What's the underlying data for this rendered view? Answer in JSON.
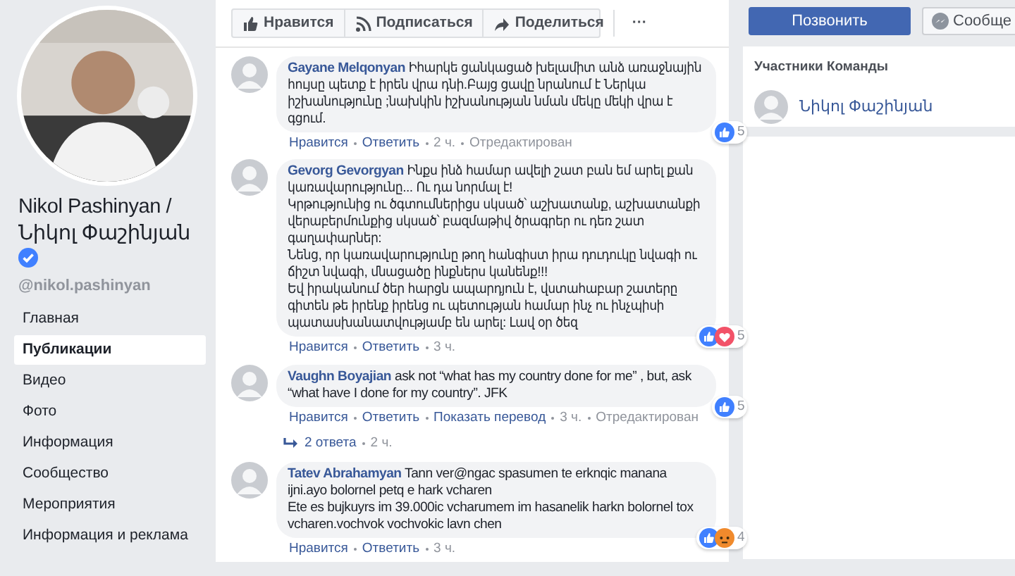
{
  "sidebar": {
    "page_name": "Nikol Pashinyan / Նիկոլ Փաշինյան",
    "verified": true,
    "handle": "@nikol.pashinyan",
    "nav": [
      {
        "label": "Главная",
        "selected": false
      },
      {
        "label": "Публикации",
        "selected": true
      },
      {
        "label": "Видео",
        "selected": false
      },
      {
        "label": "Фото",
        "selected": false
      },
      {
        "label": "Информация",
        "selected": false
      },
      {
        "label": "Сообщество",
        "selected": false
      },
      {
        "label": "Мероприятия",
        "selected": false
      },
      {
        "label": "Информация и реклама",
        "selected": false
      }
    ]
  },
  "action_bar": [
    {
      "kind": "like",
      "label": "Нравится"
    },
    {
      "kind": "follow",
      "label": "Подписаться"
    },
    {
      "kind": "share",
      "label": "Поделиться"
    },
    {
      "kind": "more",
      "label": "···"
    }
  ],
  "comments": [
    {
      "author": "Gayane Melqonyan",
      "text": "Իհարկե ցանկացած խելամիտ անձ առաջնային հույսը պետք է իրեն վրա դնի.Բայց ցավը նրանում է Ներկա իշխանությունը ;նախկին իշխանության նման մեկը մեկի վրա է գցում.",
      "reactions": [
        {
          "kind": "like"
        }
      ],
      "reaction_count": "5",
      "meta": [
        {
          "kind": "link",
          "text": "Нравится"
        },
        {
          "kind": "link",
          "text": "Ответить"
        },
        {
          "kind": "plain",
          "text": "2 ч."
        },
        {
          "kind": "plain",
          "text": "Отредактирован"
        }
      ]
    },
    {
      "author": "Gevorg Gevorgyan",
      "text": "Ինքս ինձ համար ավելի շատ բան եմ արել քան կառավարությունը... Ու դա նորմալ է!\nԿրթությունից ու ծգտումներիցս սկսած՝ աշխատանք, աշխատանքի վերաբերմունքից սկսած՝ բազմաթիվ ծրագրեր ու դեռ շատ գաղափարներ:\nՆենց, որ կառավարությունը թող հանգիստ իրա դուդուկը նվագի ու ճիշտ նվագի, մնացածը ինքներս կանենք!!!\nԵվ իրականում ծեր հարցն ապարդյուն է, վստահաբար շատերը գիտեն թե իրենք իրենց ու պետության համար ինչ ու ինչպիսի պատասխանատվությամբ են արել: Լավ օր ծեզ",
      "reactions": [
        {
          "kind": "like"
        },
        {
          "kind": "love"
        }
      ],
      "reaction_count": "5",
      "meta": [
        {
          "kind": "link",
          "text": "Нравится"
        },
        {
          "kind": "link",
          "text": "Ответить"
        },
        {
          "kind": "plain",
          "text": "3 ч."
        }
      ]
    },
    {
      "author": "Vaughn Boyajian",
      "text": "ask not “what has my country done for me” , but, ask “what have I done for my country”. JFK",
      "reactions": [
        {
          "kind": "like"
        }
      ],
      "reaction_count": "5",
      "meta": [
        {
          "kind": "link",
          "text": "Нравится"
        },
        {
          "kind": "link",
          "text": "Ответить"
        },
        {
          "kind": "link",
          "text": "Показать перевод"
        },
        {
          "kind": "plain",
          "text": "3 ч."
        },
        {
          "kind": "plain",
          "text": "Отредактирован"
        }
      ],
      "replies": {
        "label": "2 ответа",
        "time": "2 ч."
      }
    },
    {
      "author": "Tatev Abrahamyan",
      "text": "Tann ver@ngac spasumen te erknqic manana ijni.ayo bolornel petq e hark vcharen\nEte es bujkuyrs im 39.000ic vcharumem im hasanelik harkn bolornel tox vcharen.vochvok vochvokic lavn chen",
      "reactions": [
        {
          "kind": "like"
        },
        {
          "kind": "angry"
        }
      ],
      "reaction_count": "4",
      "meta": [
        {
          "kind": "link",
          "text": "Нравится"
        },
        {
          "kind": "link",
          "text": "Ответить"
        },
        {
          "kind": "plain",
          "text": "3 ч."
        }
      ]
    }
  ],
  "right": {
    "call_button": "Позвонить",
    "message_button": "Сообще",
    "team": {
      "title": "Участники Команды",
      "members": [
        {
          "name": "Նիկոլ Փաշինյան"
        }
      ]
    }
  }
}
